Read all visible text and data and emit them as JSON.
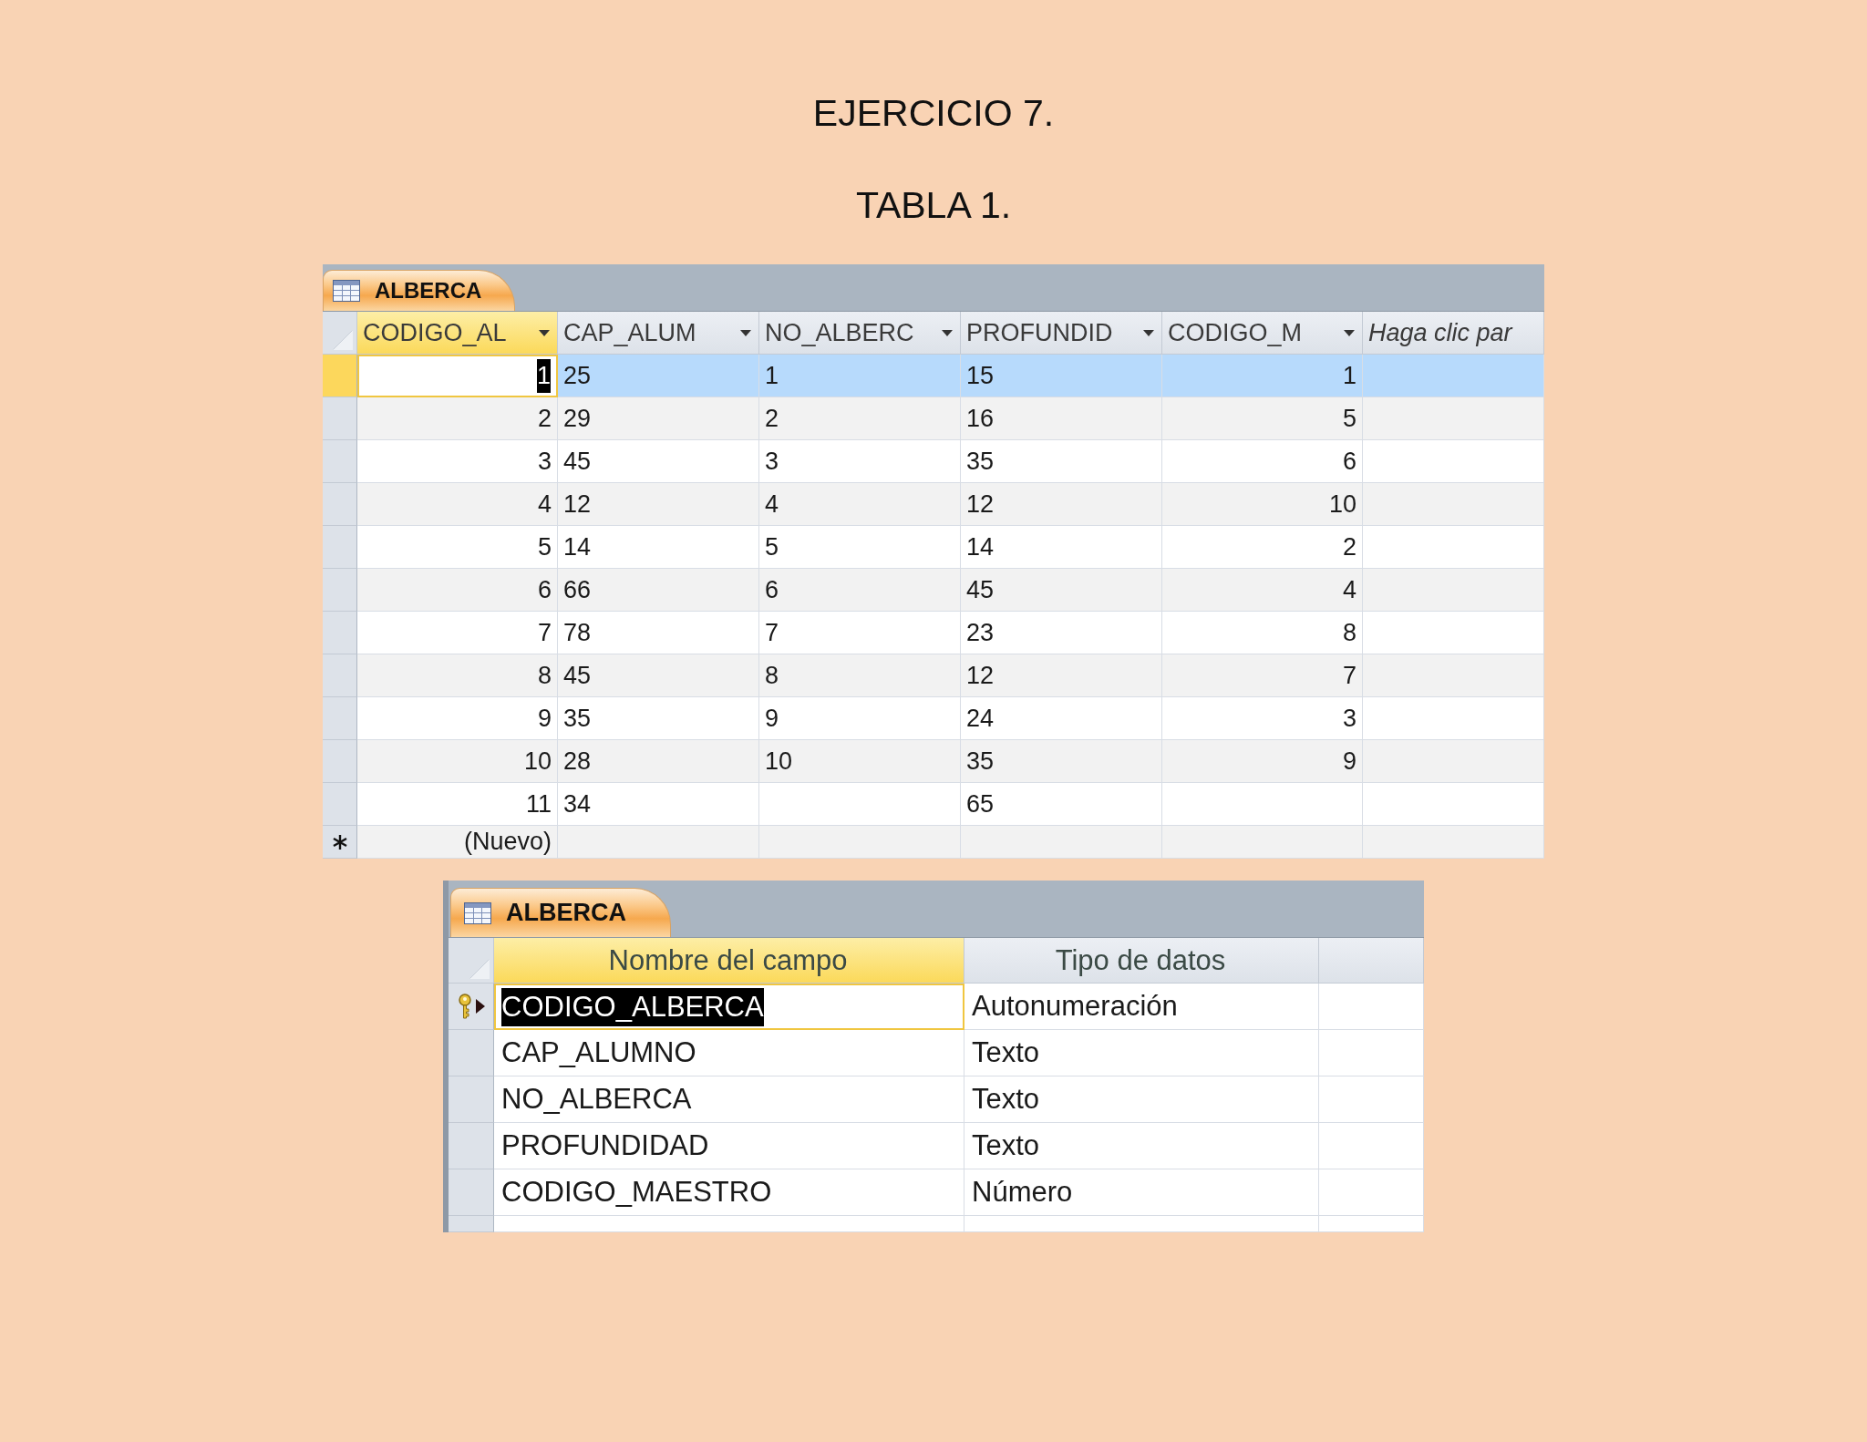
{
  "title": "EJERCICIO 7.",
  "subtitle": "TABLA 1.",
  "datasheet": {
    "tab": {
      "label": "ALBERCA",
      "selected": true
    },
    "columns": [
      {
        "label": "CODIGO_AL",
        "kind": "number",
        "selected": true
      },
      {
        "label": "CAP_ALUM",
        "kind": "text",
        "selected": false
      },
      {
        "label": "NO_ALBERC",
        "kind": "text",
        "selected": false
      },
      {
        "label": "PROFUNDID",
        "kind": "text",
        "selected": false
      },
      {
        "label": "CODIGO_M",
        "kind": "number",
        "selected": false
      },
      {
        "label": "Haga clic par",
        "kind": "add",
        "selected": false
      }
    ],
    "rows": [
      {
        "selected": true,
        "cells": [
          "1",
          "25",
          "1",
          "15",
          "1"
        ]
      },
      {
        "selected": false,
        "cells": [
          "2",
          "29",
          "2",
          "16",
          "5"
        ]
      },
      {
        "selected": false,
        "cells": [
          "3",
          "45",
          "3",
          "35",
          "6"
        ]
      },
      {
        "selected": false,
        "cells": [
          "4",
          "12",
          "4",
          "12",
          "10"
        ]
      },
      {
        "selected": false,
        "cells": [
          "5",
          "14",
          "5",
          "14",
          "2"
        ]
      },
      {
        "selected": false,
        "cells": [
          "6",
          "66",
          "6",
          "45",
          "4"
        ]
      },
      {
        "selected": false,
        "cells": [
          "7",
          "78",
          "7",
          "23",
          "8"
        ]
      },
      {
        "selected": false,
        "cells": [
          "8",
          "45",
          "8",
          "12",
          "7"
        ]
      },
      {
        "selected": false,
        "cells": [
          "9",
          "35",
          "9",
          "24",
          "3"
        ]
      },
      {
        "selected": false,
        "cells": [
          "10",
          "28",
          "10",
          "35",
          "9"
        ]
      },
      {
        "selected": false,
        "cells": [
          "11",
          "34",
          null,
          "65",
          null
        ]
      }
    ],
    "new_row": {
      "label": "(Nuevo)"
    }
  },
  "design_view": {
    "tab": {
      "label": "ALBERCA",
      "selected": true
    },
    "columns": [
      {
        "label": "Nombre del campo",
        "selected": true
      },
      {
        "label": "Tipo de datos",
        "selected": false
      }
    ],
    "rows": [
      {
        "selected": true,
        "primary_key": true,
        "field_name": "CODIGO_ALBERCA",
        "data_type": "Autonumeración"
      },
      {
        "selected": false,
        "primary_key": false,
        "field_name": "CAP_ALUMNO",
        "data_type": "Texto"
      },
      {
        "selected": false,
        "primary_key": false,
        "field_name": "NO_ALBERCA",
        "data_type": "Texto"
      },
      {
        "selected": false,
        "primary_key": false,
        "field_name": "PROFUNDIDAD",
        "data_type": "Texto"
      },
      {
        "selected": false,
        "primary_key": false,
        "field_name": "CODIGO_MAESTRO",
        "data_type": "Número"
      }
    ]
  }
}
